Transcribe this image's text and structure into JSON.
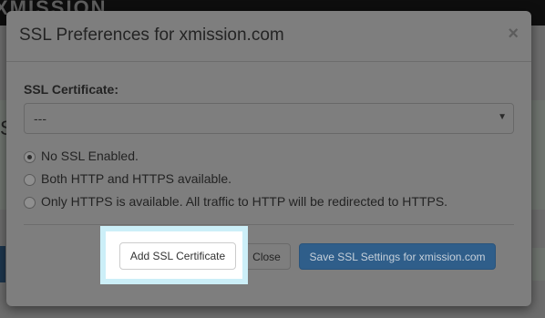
{
  "background": {
    "logo_text": "XMISSION",
    "partial_char": "S"
  },
  "modal": {
    "title": "SSL Preferences for xmission.com",
    "close_glyph": "×",
    "certificate": {
      "label": "SSL Certificate:",
      "selected_value": "---"
    },
    "radio_options": [
      {
        "label": "No SSL Enabled.",
        "checked": true
      },
      {
        "label": "Both HTTP and HTTPS available.",
        "checked": false
      },
      {
        "label": "Only HTTPS is available. All traffic to HTTP will be redirected to HTTPS.",
        "checked": false
      }
    ],
    "footer": {
      "add_label": "Add SSL Certificate",
      "close_label": "Close",
      "save_label": "Save SSL Settings for xmission.com"
    }
  },
  "colors": {
    "primary_button": "#2f5e8a",
    "highlight": "#cceff8"
  }
}
